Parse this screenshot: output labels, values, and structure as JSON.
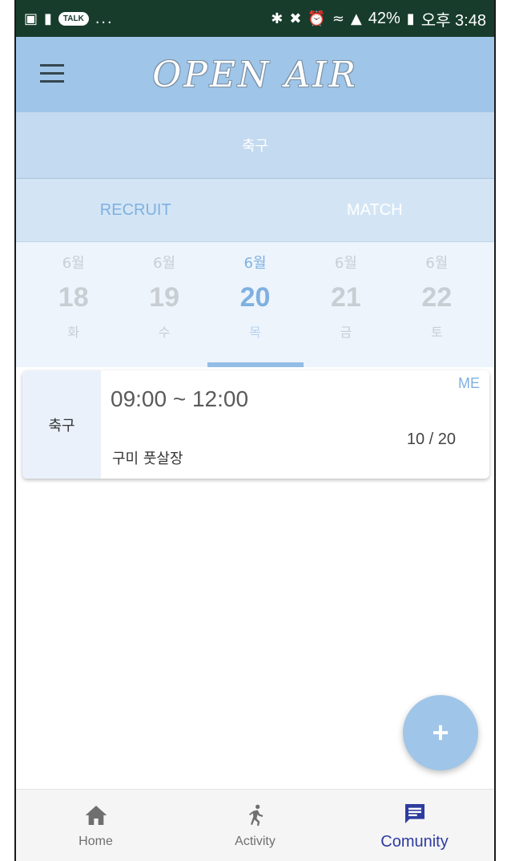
{
  "status_bar": {
    "left_icons": [
      "gallery-icon",
      "message-icon",
      "chat-icon"
    ],
    "talk_badge": "TALK",
    "more": "...",
    "right_icons": [
      "bluetooth-icon",
      "mute-icon",
      "alarm-icon",
      "wifi-icon",
      "signal-icon"
    ],
    "battery": "42%",
    "time": "오후 3:48"
  },
  "header": {
    "brand": "OPEN AIR"
  },
  "sport": {
    "label": "축구"
  },
  "tabs": [
    {
      "label": "RECRUIT",
      "active": true
    },
    {
      "label": "MATCH",
      "active": false
    }
  ],
  "dates": [
    {
      "month": "6월",
      "day": "18",
      "weekday": "화"
    },
    {
      "month": "6월",
      "day": "19",
      "weekday": "수"
    },
    {
      "month": "6월",
      "day": "20",
      "weekday": "목",
      "selected": true
    },
    {
      "month": "6월",
      "day": "21",
      "weekday": "금"
    },
    {
      "month": "6월",
      "day": "22",
      "weekday": "토"
    }
  ],
  "card": {
    "sport": "축구",
    "time": "09:00 ~ 12:00",
    "place": "구미 풋살장",
    "badge": "ME",
    "count": "10 / 20"
  },
  "fab": {
    "label": "+"
  },
  "bottom_nav": [
    {
      "label": "Home",
      "icon": "home-icon"
    },
    {
      "label": "Activity",
      "icon": "running-icon"
    },
    {
      "label": "Comunity",
      "icon": "chat-bubble-icon",
      "active": true
    }
  ],
  "colors": {
    "header": "#9fc5e8",
    "accent": "#7fb0e0",
    "active_nav": "#2e3c9f",
    "status_bar": "#173c2c"
  }
}
